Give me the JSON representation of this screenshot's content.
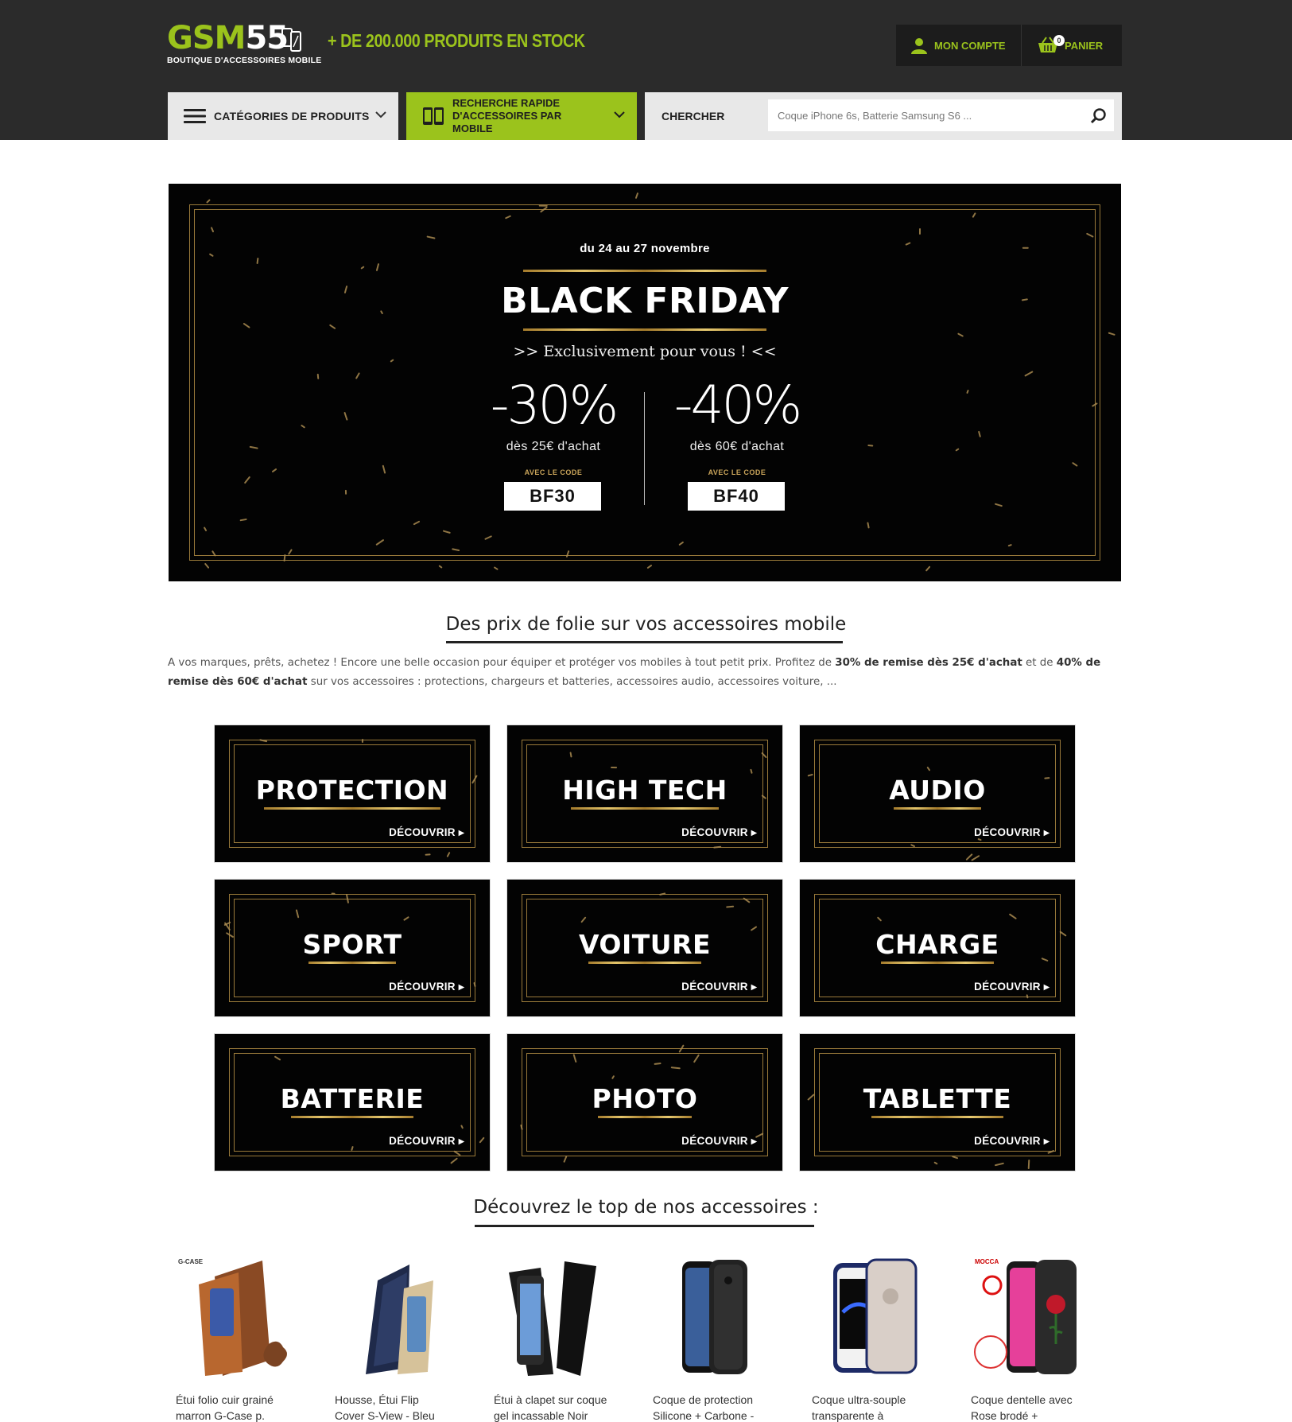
{
  "header": {
    "logo_main": "GSM55",
    "logo_sub": "BOUTIQUE D'ACCESSOIRES MOBILE",
    "stock_text": "+ DE 200.000 PRODUITS EN STOCK",
    "account_label": "MON COMPTE",
    "cart_label": "PANIER",
    "cart_count": "0"
  },
  "nav": {
    "categories_label": "CATÉGORIES DE PRODUITS",
    "quick_search_label": "RECHERCHE RAPIDE D'ACCESSOIRES PAR MOBILE",
    "search_label": "CHERCHER",
    "search_placeholder": "Coque iPhone 6s, Batterie Samsung S6 ..."
  },
  "banner": {
    "date": "du 24 au 27 novembre",
    "title": "BLACK FRIDAY",
    "subtitle": ">>  Exclusivement pour vous !  <<",
    "offers": [
      {
        "discount": "-30%",
        "condition": "dès 25€ d'achat",
        "code_label": "AVEC LE CODE",
        "code": "BF30"
      },
      {
        "discount": "-40%",
        "condition": "dès 60€ d'achat",
        "code_label": "AVEC LE CODE",
        "code": "BF40"
      }
    ]
  },
  "section1": {
    "title": "Des prix de folie sur vos accessoires mobile",
    "intro_part1": "A vos marques, prêts, achetez ! Encore une belle occasion pour équiper et protéger vos mobiles à tout petit prix. Profitez de ",
    "intro_bold1": "30% de remise dès 25€ d'achat",
    "intro_part2": " et de ",
    "intro_bold2": "40% de remise dès 60€ d'achat",
    "intro_part3": " sur vos accessoires : protections, chargeurs et batteries, accessoires audio, accessoires voiture, ..."
  },
  "categories": {
    "cta": "DÉCOUVRIR",
    "items": [
      "PROTECTION",
      "HIGH TECH",
      "AUDIO",
      "SPORT",
      "VOITURE",
      "CHARGE",
      "BATTERIE",
      "PHOTO",
      "TABLETTE"
    ]
  },
  "section2": {
    "title": "Découvrez le top de nos accessoires :"
  },
  "products": [
    {
      "name_line1": "Étui folio cuir grainé",
      "name_line2": "marron G-Case p.",
      "brand": "G-CASE"
    },
    {
      "name_line1": "Housse, Étui Flip",
      "name_line2": "Cover S-View - Bleu",
      "brand": ""
    },
    {
      "name_line1": "Étui à clapet sur coque",
      "name_line2": "gel incassable Noir",
      "brand": ""
    },
    {
      "name_line1": "Coque de protection",
      "name_line2": "Silicone + Carbone -",
      "brand": ""
    },
    {
      "name_line1": "Coque ultra-souple",
      "name_line2": "transparente à",
      "brand": ""
    },
    {
      "name_line1": "Coque dentelle avec",
      "name_line2": "Rose brodé +",
      "brand": "MOCCA"
    }
  ],
  "colors": {
    "brand_green": "#9bc31c",
    "header_bg": "#2b2b2b",
    "gold": "#c9a45a"
  }
}
